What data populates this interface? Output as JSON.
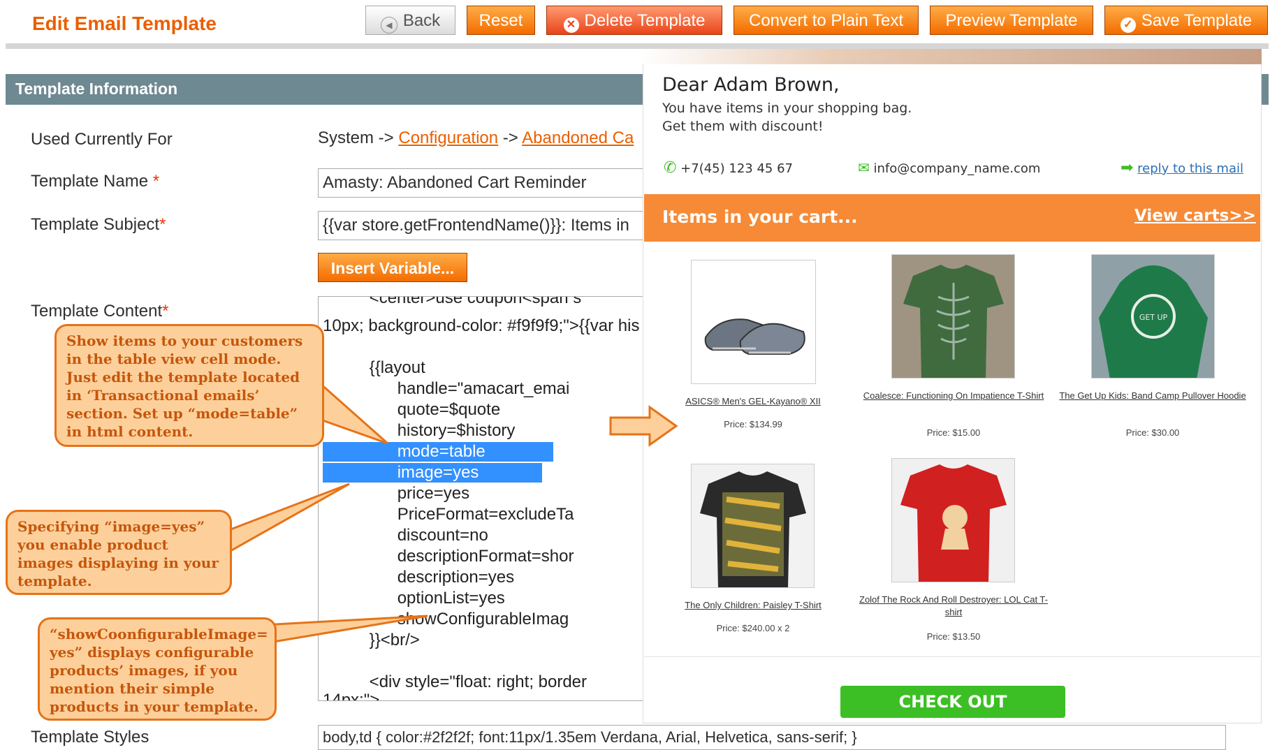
{
  "header": {
    "title": "Edit Email Template",
    "buttons": {
      "back": "Back",
      "reset": "Reset",
      "delete": "Delete Template",
      "convert": "Convert to Plain Text",
      "preview": "Preview Template",
      "save": "Save Template"
    }
  },
  "section": {
    "title": "Template Information"
  },
  "form": {
    "used_for_label": "Used Currently For",
    "used_for_prefix": "System -> ",
    "used_for_link1": "Configuration",
    "used_for_sep": " -> ",
    "used_for_link2": "Abandoned Ca",
    "name_label": "Template Name",
    "name_value": "Amasty: Abandoned Cart Reminder",
    "subject_label": "Template Subject",
    "subject_value": "{{var store.getFrontendName()}}: Items in",
    "required_mark": "*",
    "insert_variable": "Insert Variable...",
    "content_label": "Template Content",
    "content_lines": [
      "          <center>use coupon<span s",
      "10px; background-color: #f9f9f9;\">{{var his",
      "",
      "          {{layout",
      "                handle=\"amacart_emai",
      "                quote=$quote",
      "                history=$history",
      "                mode=table",
      "                image=yes",
      "                price=yes",
      "                PriceFormat=excludeTa",
      "                discount=no",
      "                descriptionFormat=shor",
      "                description=yes",
      "                optionList=yes",
      "                showConfigurableImag",
      "          }}<br/>",
      "",
      "          <div style=\"float: right; border",
      "14px;\">"
    ],
    "styles_label": "Template Styles",
    "styles_value": "body,td { color:#2f2f2f; font:11px/1.35em Verdana, Arial, Helvetica, sans-serif; }"
  },
  "callouts": {
    "table_mode": "Show items to your customers in the table view cell mode. Just edit the template located in ‘Transactional emails’ section. Set up  “mode=table” in html content.",
    "image_yes": "Specifying “image=yes” you enable product images displaying in your template.",
    "configurable": "“showCoonfigurableImage= yes” displays configurable products’ images, if you mention their simple products in your template."
  },
  "preview": {
    "greeting": "Dear Adam Brown,",
    "line1": "You have items in your shopping bag.",
    "line2": "Get them with discount!",
    "phone": "+7(45) 123 45 67",
    "email": "info@company_name.com",
    "reply": "reply to this mail",
    "cart_title": "Items in your cart...",
    "view_carts": "View carts>>",
    "products": [
      {
        "name": "ASICS® Men's GEL-Kayano® XII",
        "price": "Price: $134.99"
      },
      {
        "name": "Coalesce: Functioning On Impatience T-Shirt",
        "price": "Price: $15.00"
      },
      {
        "name": "The Get Up Kids: Band Camp Pullover Hoodie",
        "price": "Price: $30.00"
      },
      {
        "name": "The Only Children: Paisley T-Shirt",
        "price": "Price: $240.00 x 2"
      },
      {
        "name": "Zolof The Rock And Roll Destroyer: LOL Cat T-shirt",
        "price": "Price: $13.50"
      }
    ],
    "checkout": "CHECK OUT"
  },
  "colors": {
    "accent": "#eb5e00",
    "button_orange": "#f36c00",
    "section_bar": "#6f8992",
    "highlight": "#3390ff",
    "checkout_green": "#3cbf24"
  }
}
